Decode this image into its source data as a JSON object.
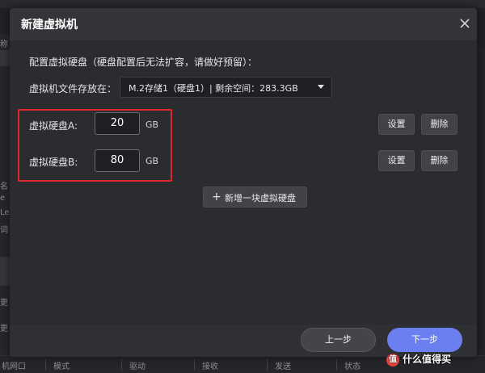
{
  "background": {
    "left_texts": [
      "称",
      "名",
      "e",
      "Le",
      "词",
      "更",
      "更"
    ],
    "footer_columns": [
      "机网口",
      "模式",
      "驱动",
      "接收",
      "发送",
      "状态"
    ]
  },
  "dialog": {
    "title": "新建虚拟机",
    "section_title": "配置虚拟硬盘（硬盘配置后无法扩容，请做好预留）：",
    "location_label": "虚拟机文件存放在：",
    "location_value": "M.2存储1（硬盘1）| 剩余空间：283.3GB",
    "disks": [
      {
        "label": "虚拟硬盘A:",
        "size": "20",
        "unit": "GB",
        "settings": "设置",
        "delete": "删除"
      },
      {
        "label": "虚拟硬盘B:",
        "size": "80",
        "unit": "GB",
        "settings": "设置",
        "delete": "删除"
      }
    ],
    "add_disk": "新增一块虚拟硬盘",
    "prev": "上一步",
    "next": "下一步"
  },
  "watermark": "什么值得买",
  "colors": {
    "accent": "#6b7ff0",
    "highlight": "#e0262f"
  },
  "icons": {
    "close": "close-icon",
    "dropdown": "chevron-down-icon",
    "add": "plus-icon"
  }
}
